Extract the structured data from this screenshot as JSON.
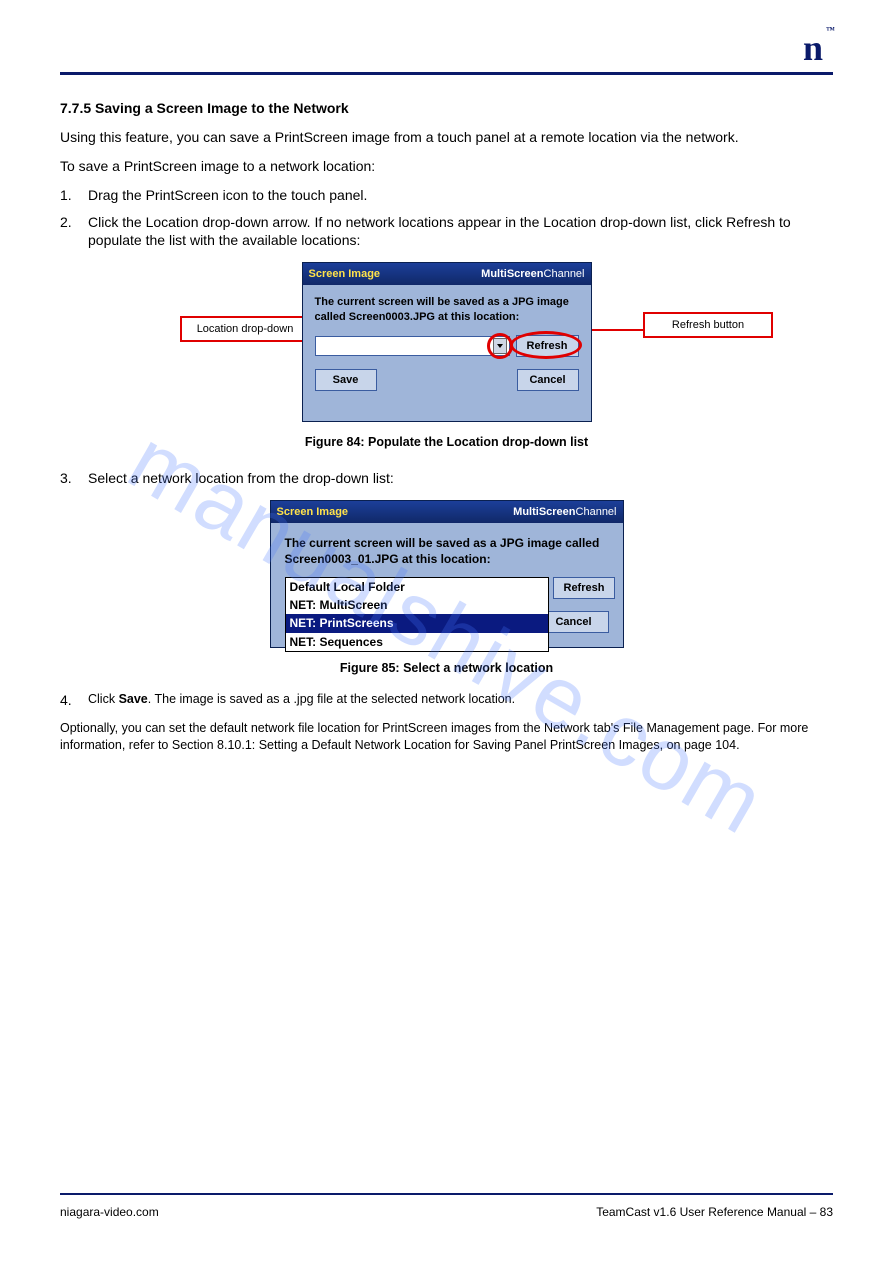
{
  "brand": {
    "mark": "n",
    "tm": "™"
  },
  "intro": {
    "title": "7.7.5 Saving a Screen Image to the Network",
    "p1": "Using this feature, you can save a PrintScreen image from a touch panel at a remote location via the network.",
    "p2": "To save a PrintScreen image to a network location:"
  },
  "steps": {
    "s1num": "1.",
    "s1": "Drag the PrintScreen icon to the touch panel.",
    "s2num": "2.",
    "s2": "Click the Location drop-down arrow. If no network locations appear in the Location drop-down list, click Refresh to populate the list with the available locations:"
  },
  "fig1": {
    "caption": "Figure 84: Populate the Location drop-down list",
    "dlg_title": "Screen Image",
    "brand1": "MultiScreen",
    "brand2": "Channel",
    "msg": "The current screen will be saved as a JPG image called Screen0003.JPG at this location:",
    "refresh": "Refresh",
    "save": "Save",
    "cancel": "Cancel",
    "callout_left": "Location drop-down",
    "callout_right": "Refresh button"
  },
  "mid": {
    "s3num": "3.",
    "s3": "Select a network location from the drop-down list:"
  },
  "fig2": {
    "caption": "Figure 85: Select a network location",
    "dlg_title": "Screen Image",
    "brand1": "MultiScreen",
    "brand2": "Channel",
    "msg": "The current screen will be saved as a JPG image called Screen0003_01.JPG at this location:",
    "selected": "NET: PrintScreens",
    "opts": [
      "Default Local Folder",
      "NET: MultiScreen",
      "NET: PrintScreens",
      "NET: Sequences"
    ],
    "refresh": "Refresh",
    "cancel": "Cancel"
  },
  "after": {
    "s4num": "4.",
    "s4a": "Click ",
    "s4b": "Save",
    "s4c": ". The image is saved as a .jpg file at the selected network location.",
    "p3": "Optionally, you can set the default network file location for PrintScreen images from the Network tab's File Management page. For more information, refer to Section 8.10.1: Setting a Default Network Location for Saving Panel PrintScreen Images, on page 104."
  },
  "watermark": "manualshive.com",
  "footer": {
    "left": "niagara-video.com",
    "right": "TeamCast v1.6 User Reference Manual – 83"
  }
}
